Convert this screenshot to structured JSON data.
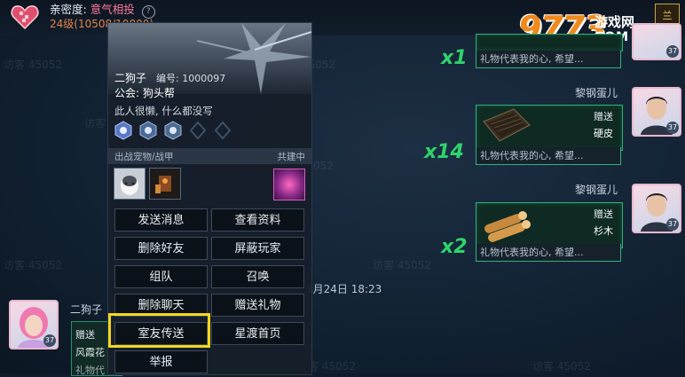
{
  "header": {
    "intimacy_label": "亲密度:",
    "intimacy_value": "意气相投",
    "help": "?",
    "level_text": "24级(10508/10800)",
    "corner_icon": "兰"
  },
  "logo": {
    "number": "9773",
    "name": "游戏网",
    "domain": "COM"
  },
  "watermark": "访客 45052",
  "chat": {
    "timestamp": "5月24日 18:23",
    "messages": [
      {
        "sender": "",
        "multiplier": "x1",
        "action": "",
        "item": "",
        "footer": "礼物代表我的心, 希望...",
        "avatar_level": "37"
      },
      {
        "sender": "黎钢蛋儿",
        "multiplier": "x14",
        "action": "赠送",
        "item": "硬皮",
        "footer": "礼物代表我的心, 希望...",
        "avatar_level": "37"
      },
      {
        "sender": "黎钢蛋儿",
        "multiplier": "x2",
        "action": "赠送",
        "item": "杉木",
        "footer": "礼物代表我的心, 希望...",
        "avatar_level": "37"
      }
    ],
    "left": {
      "sender": "二狗子",
      "avatar_level": "37",
      "lines": [
        "赠送",
        "风霞花",
        "礼物代"
      ]
    }
  },
  "profile": {
    "name": "二狗子",
    "id_label": "编号: 1000097",
    "guild": "公会: 狗头帮",
    "signature": "此人很懒, 什么都没写",
    "section_left": "出战宠物/战甲",
    "section_right": "共建中",
    "buttons": [
      "发送消息",
      "查看资料",
      "删除好友",
      "屏蔽玩家",
      "组队",
      "召唤",
      "删除聊天",
      "赠送礼物",
      "室友传送",
      "星渡首页",
      "举报"
    ]
  },
  "colors": {
    "accent_green": "#2fd36b",
    "highlight": "#f4d71d",
    "intimacy": "#ff7a9a",
    "level": "#e1834a"
  }
}
